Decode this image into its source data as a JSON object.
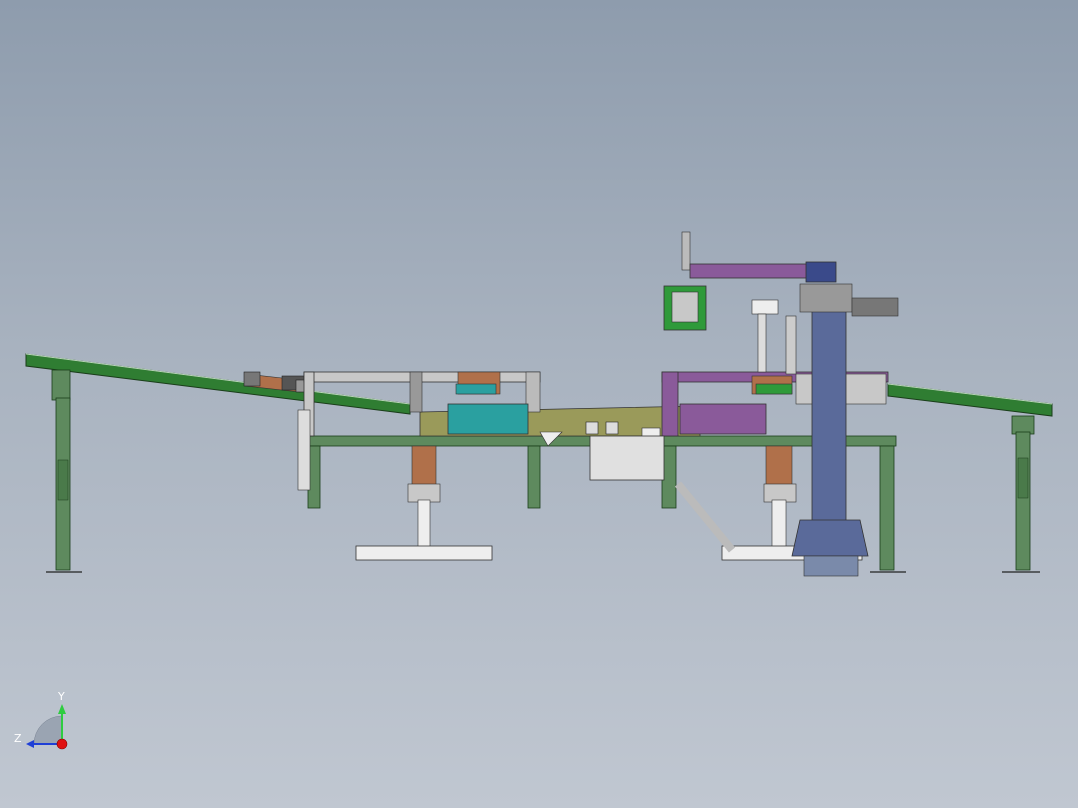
{
  "view": {
    "background_top": "#8e9cad",
    "background_bottom": "#c0c7d1"
  },
  "triad": {
    "y_label": "Y",
    "z_label": "Z",
    "y_color": "#2ecc40",
    "z_color": "#1f3fd6",
    "x_color": "#e01010"
  },
  "colors": {
    "frame_green": "#5e8a5e",
    "conveyor_green": "#2f7d32",
    "steel": "#c8c8c8",
    "olive_table": "#9a9a5a",
    "purple_part": "#8a5a9a",
    "teal_part": "#2aa0a0",
    "rust_part": "#b0704a",
    "navy_column": "#5a6a9a"
  }
}
